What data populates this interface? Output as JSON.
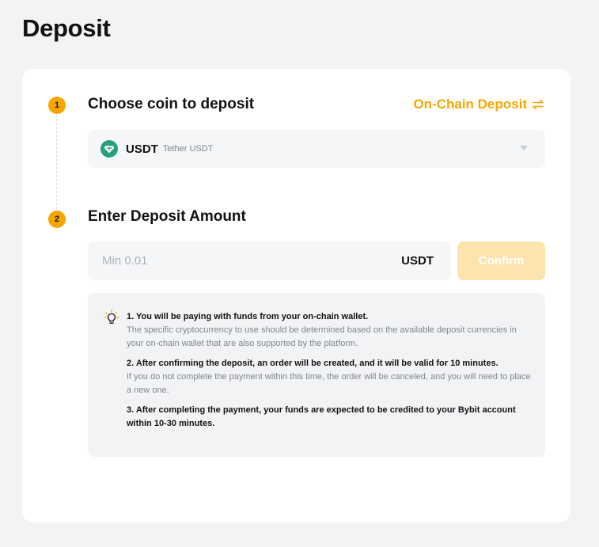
{
  "page": {
    "title": "Deposit"
  },
  "step1": {
    "number": "1",
    "title": "Choose coin to deposit",
    "switch_link": "On-Chain Deposit",
    "coin": {
      "symbol": "USDT",
      "name": "Tether USDT",
      "icon": "tether-icon",
      "color": "#26a17b"
    }
  },
  "step2": {
    "number": "2",
    "title": "Enter Deposit Amount",
    "amount": {
      "value": "",
      "placeholder": "Min 0.01",
      "unit": "USDT"
    },
    "confirm_label": "Confirm"
  },
  "notice": {
    "icon": "lightbulb-icon",
    "items": [
      {
        "heading": "1. You will be paying with funds from your on-chain wallet.",
        "text": "The specific cryptocurrency to use should be determined based on the available deposit currencies in your on-chain wallet that are also supported by the platform."
      },
      {
        "heading": "2. After confirming the deposit, an order will be created, and it will be valid for 10 minutes.",
        "text": "If you do not complete the payment within this time, the order will be canceled, and you will need to place a new one."
      },
      {
        "heading": "3. After completing the payment, your funds are expected to be credited to your Bybit account within 10-30 minutes.",
        "text": ""
      }
    ]
  },
  "colors": {
    "accent": "#f7a600",
    "confirm_disabled": "#fde3ad",
    "background": "#f2f3f5",
    "card": "#ffffff"
  }
}
